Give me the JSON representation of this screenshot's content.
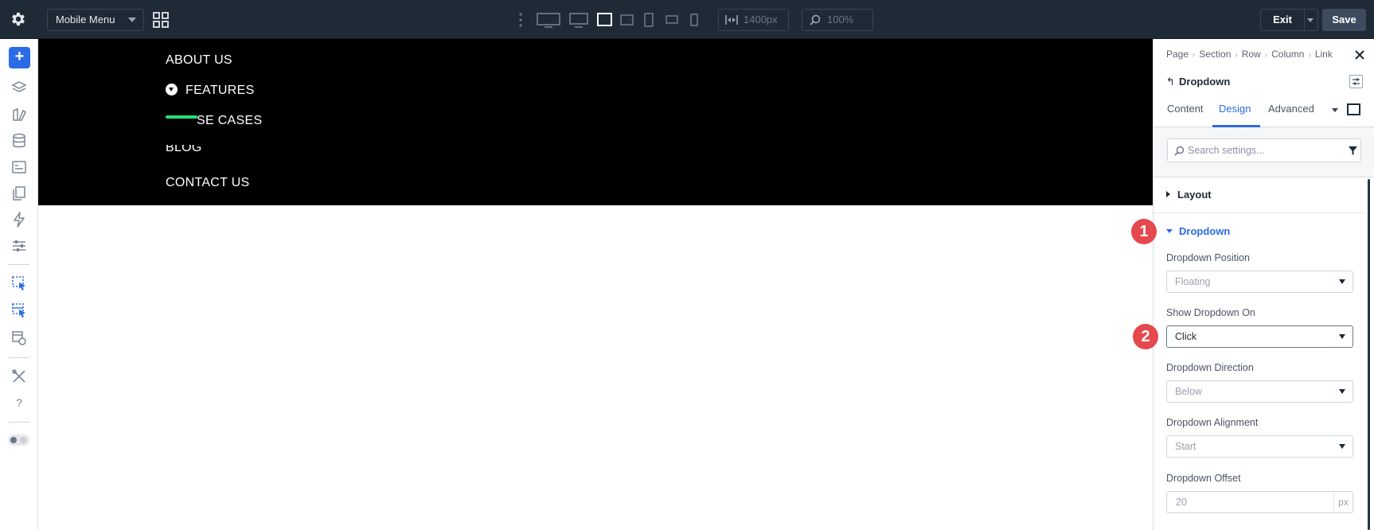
{
  "topbar": {
    "menu_select": "Mobile Menu",
    "width_value": "1400px",
    "zoom_value": "100%",
    "exit_label": "Exit",
    "save_label": "Save"
  },
  "canvas": {
    "menu_items": [
      "ABOUT US",
      "FEATURES",
      "SE CASES",
      "BLOG",
      "CONTACT US"
    ]
  },
  "panel": {
    "breadcrumbs": [
      "Page",
      "Section",
      "Row",
      "Column",
      "Link"
    ],
    "element_title": "Dropdown",
    "tabs": [
      "Content",
      "Design",
      "Advanced"
    ],
    "active_tab": "Design",
    "search_placeholder": "Search settings...",
    "sections": {
      "layout": "Layout",
      "dropdown": "Dropdown"
    },
    "fields": {
      "position_label": "Dropdown Position",
      "position_value": "Floating",
      "show_on_label": "Show Dropdown On",
      "show_on_value": "Click",
      "direction_label": "Dropdown Direction",
      "direction_value": "Below",
      "alignment_label": "Dropdown Alignment",
      "alignment_value": "Start",
      "offset_label": "Dropdown Offset",
      "offset_value": "20",
      "offset_unit": "px"
    }
  },
  "markers": [
    "1",
    "2"
  ],
  "colors": {
    "topbar_bg": "#1f2a37",
    "accent": "#2b6be6",
    "marker": "#e5484d",
    "menu_bg": "#000000",
    "highlight_bar": "#22e07a"
  }
}
